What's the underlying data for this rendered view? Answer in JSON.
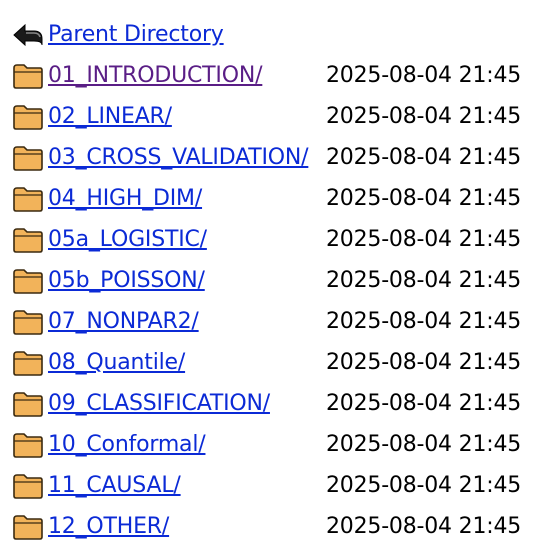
{
  "parent": {
    "label": "Parent Directory",
    "icon": "back-arrow-icon"
  },
  "entries": [
    {
      "name": "01_INTRODUCTION/",
      "date": "2025-08-04 21:45",
      "visited": true
    },
    {
      "name": "02_LINEAR/",
      "date": "2025-08-04 21:45"
    },
    {
      "name": "03_CROSS_VALIDATION/",
      "date": "2025-08-04 21:45"
    },
    {
      "name": "04_HIGH_DIM/",
      "date": "2025-08-04 21:45"
    },
    {
      "name": "05a_LOGISTIC/",
      "date": "2025-08-04 21:45"
    },
    {
      "name": "05b_POISSON/",
      "date": "2025-08-04 21:45"
    },
    {
      "name": "07_NONPAR2/",
      "date": "2025-08-04 21:45"
    },
    {
      "name": "08_Quantile/",
      "date": "2025-08-04 21:45"
    },
    {
      "name": "09_CLASSIFICATION/",
      "date": "2025-08-04 21:45"
    },
    {
      "name": "10_Conformal/",
      "date": "2025-08-04 21:45"
    },
    {
      "name": "11_CAUSAL/",
      "date": "2025-08-04 21:45"
    },
    {
      "name": "12_OTHER/",
      "date": "2025-08-04 21:45"
    }
  ],
  "colors": {
    "link": "#0b2ad6",
    "visited_link": "#5a1e86",
    "folder_fill": "#f2b35a",
    "folder_outline": "#3b2a10"
  },
  "folder_icon": "folder-icon"
}
